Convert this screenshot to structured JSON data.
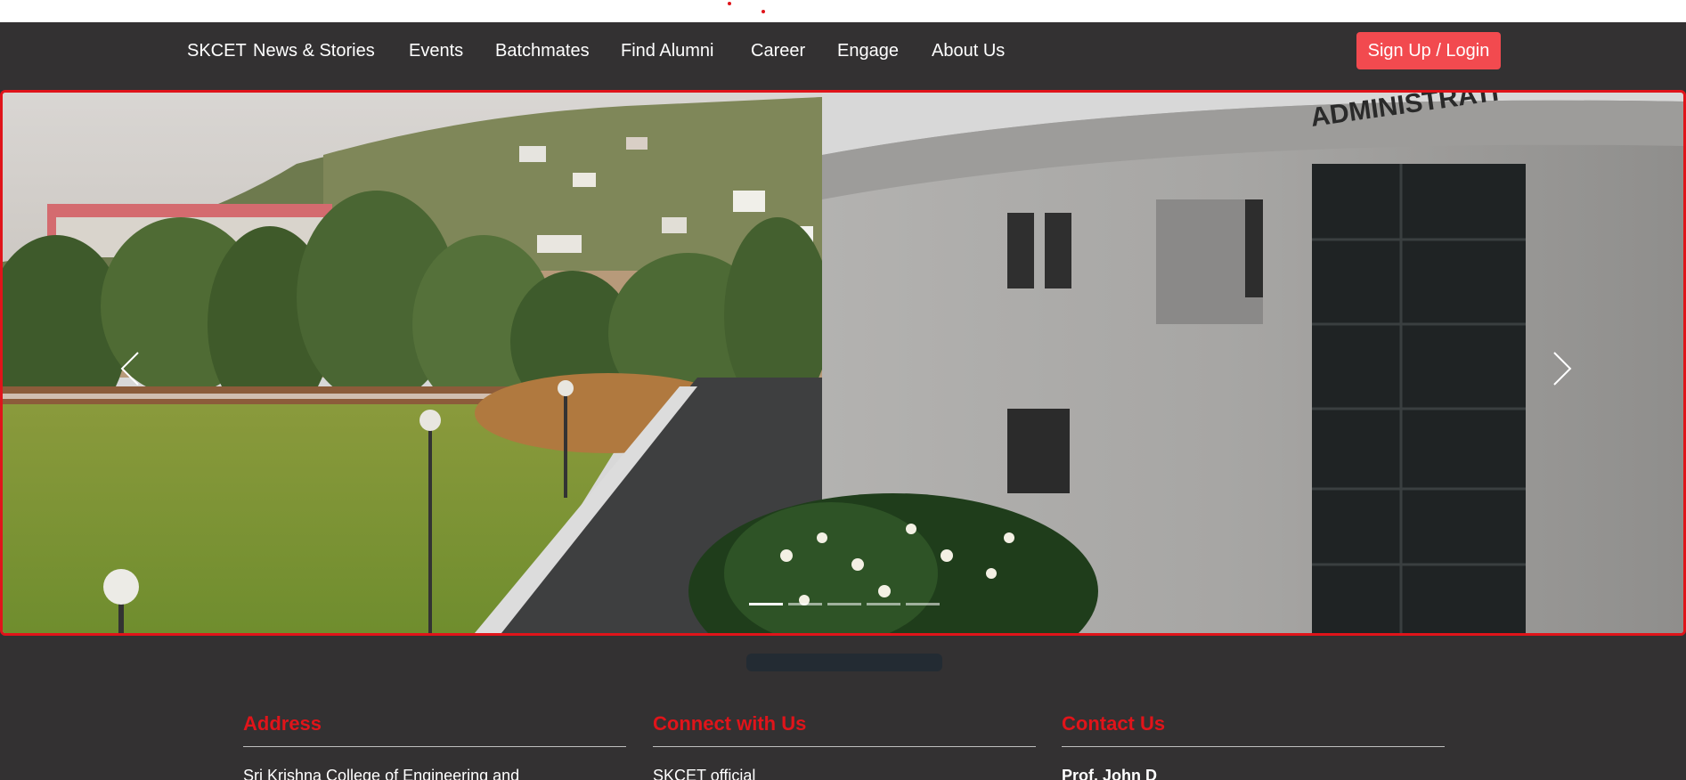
{
  "navbar": {
    "brand": "SKCET",
    "items": [
      {
        "label": "News & Stories"
      },
      {
        "label": "Events"
      },
      {
        "label": "Batchmates"
      },
      {
        "label": "Find Alumni"
      },
      {
        "label": "Career"
      },
      {
        "label": "Engage"
      },
      {
        "label": "About Us"
      }
    ],
    "login_label": "Sign Up / Login"
  },
  "carousel": {
    "slide_image": "campus-administration-building-photo",
    "prev_icon": "chevron-left-icon",
    "next_icon": "chevron-right-icon",
    "slide_count": 5,
    "active_slide": 1,
    "building_sign": "ADMINISTRATI"
  },
  "footer": {
    "columns": [
      {
        "title": "Address",
        "text": "Sri Krishna College of Engineering and"
      },
      {
        "title": "Connect with Us",
        "text": "SKCET official"
      },
      {
        "title": "Contact Us",
        "text": "Prof. John D"
      }
    ]
  },
  "colors": {
    "background": "#333132",
    "accent": "#e0141a",
    "login_button": "#f24a4f"
  }
}
